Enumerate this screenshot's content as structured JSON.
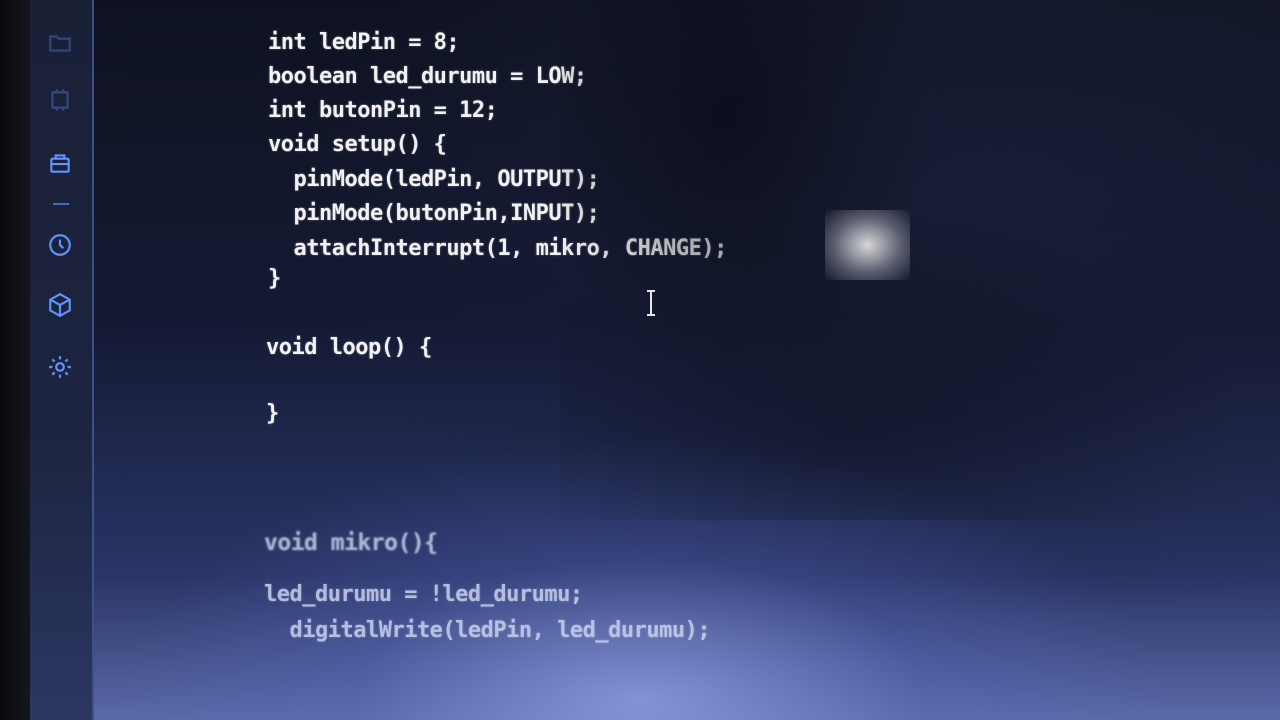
{
  "activity_bar": {
    "icons": [
      {
        "name": "folder-icon"
      },
      {
        "name": "board-icon"
      },
      {
        "name": "library-icon"
      },
      {
        "name": "debug-icon"
      },
      {
        "name": "cube-icon"
      },
      {
        "name": "gear-icon"
      }
    ],
    "accent_color": "#4f7fd6"
  },
  "editor": {
    "code_lines": [
      "int ledPin = 8;",
      "boolean led_durumu = LOW;",
      "int butonPin = 12;",
      "void setup() {",
      "  pinMode(ledPin, OUTPUT);",
      "  pinMode(butonPin,INPUT);",
      "  attachInterrupt(1, mikro, CHANGE);",
      "}",
      "void loop() {",
      "}",
      "void mikro(){",
      "led_durumu = !led_durumu;",
      "  digitalWrite(ledPin, led_durumu);"
    ]
  }
}
